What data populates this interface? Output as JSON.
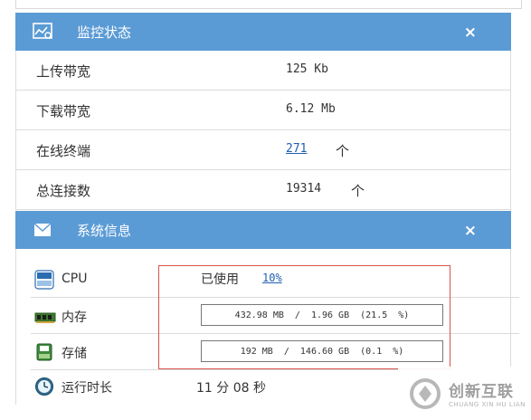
{
  "monitor": {
    "title": "监控状态",
    "close": "×",
    "rows": [
      {
        "label": "上传带宽",
        "value": "125 Kb"
      },
      {
        "label": "下载带宽",
        "value": "6.12 Mb"
      },
      {
        "label": "在线终端",
        "value": "271",
        "unit": "个"
      },
      {
        "label": "总连接数",
        "value": "19314",
        "unit": "个"
      }
    ]
  },
  "system": {
    "title": "系统信息",
    "close": "×",
    "cpu": {
      "label": "CPU",
      "used_label": "已使用",
      "used_value": "10%"
    },
    "memory": {
      "label": "内存",
      "text": "432.98 MB  /  1.96 GB  (21.5  %)"
    },
    "storage": {
      "label": "存储",
      "text": "192 MB  /  146.60 GB  (0.1  %)"
    },
    "uptime": {
      "label": "运行时长",
      "value": "11 分 08 秒"
    }
  },
  "icons": {
    "monitor": "chart-icon",
    "system": "envelope-icon",
    "cpu": "intel-atom-icon",
    "memory": "ram-icon",
    "storage": "disk-icon",
    "uptime": "clock-icon"
  },
  "watermark": {
    "cn": "创新互联",
    "en": "CHUANG XIN HU LIAN"
  },
  "colors": {
    "header": "#5b9bd5",
    "link": "#1f5fb0",
    "highlight_box": "#d9534f"
  }
}
